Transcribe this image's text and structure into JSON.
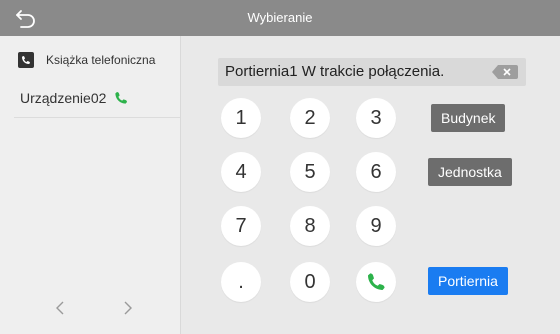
{
  "header": {
    "title": "Wybieranie"
  },
  "sidebar": {
    "phonebook_label": "Książka telefoniczna",
    "device_label": "Urządzenie02"
  },
  "dial": {
    "status_text": "Portiernia1 W trakcie połączenia.",
    "keys": [
      "1",
      "2",
      "3",
      "4",
      "5",
      "6",
      "7",
      "8",
      "9",
      ".",
      "0"
    ]
  },
  "buttons": {
    "building": "Budynek",
    "unit": "Jednostka",
    "guard": "Portiernia"
  },
  "colors": {
    "topbar": "#8a8a8a",
    "call_green": "#2db24b",
    "accent_blue": "#1a7cf1",
    "button_gray": "#6d6d6d"
  },
  "icons": {
    "back": "back-arrow-icon",
    "phonebook": "phonebook-icon",
    "phone": "phone-icon",
    "backspace": "backspace-icon",
    "prev": "chevron-left-icon",
    "next": "chevron-right-icon"
  }
}
